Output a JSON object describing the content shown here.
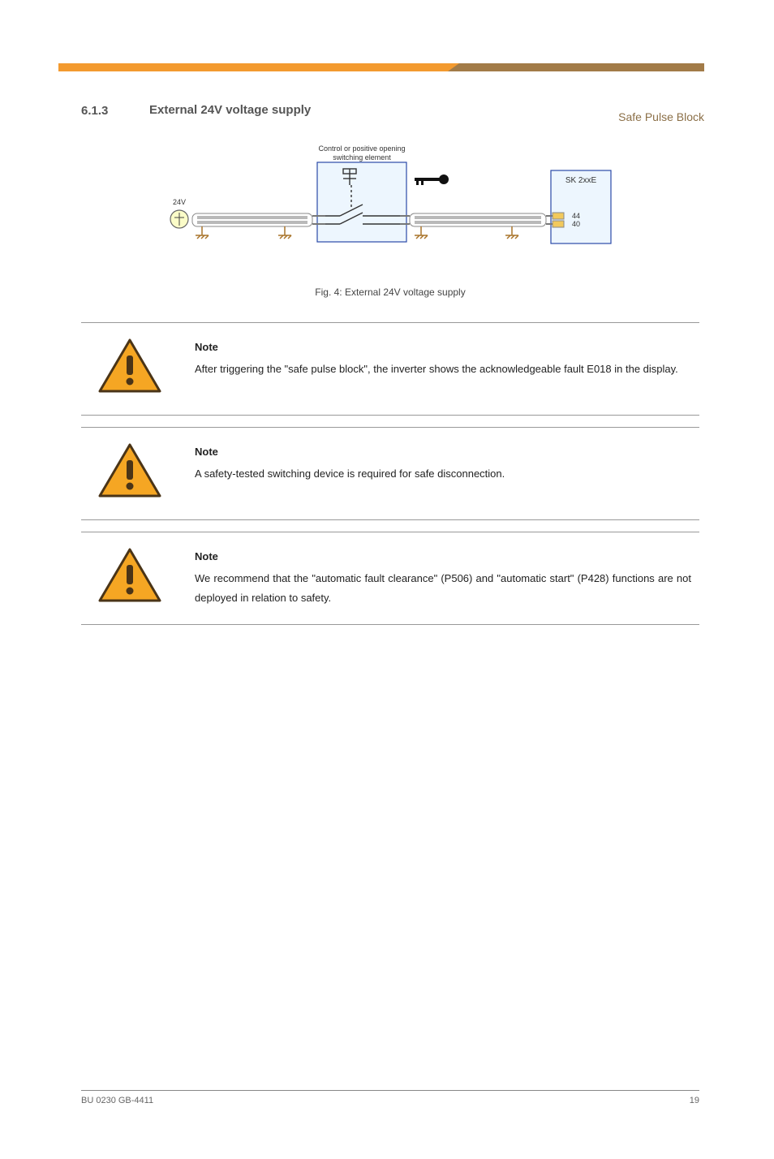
{
  "header": {
    "doc_title": "Safe Pulse Block"
  },
  "section": {
    "number": "6.1.3",
    "title": "External 24V voltage supply"
  },
  "figure": {
    "labels": {
      "source": "24V",
      "unit": "Control or positive opening\nswitching element",
      "device": "SK 2xxE",
      "port1": "44",
      "port2": "40"
    },
    "caption": "Fig. 4: External 24V voltage supply"
  },
  "notes": [
    {
      "label": "Note",
      "text": "After triggering the \"safe pulse block\", the inverter shows the acknowledgeable fault E018 in the display."
    },
    {
      "label": "Note",
      "text": "A safety-tested switching device is required for safe disconnection."
    },
    {
      "label": "Note",
      "text": "We recommend that the \"automatic fault clearance\" (P506) and \"automatic start\" (P428) functions are not deployed in relation to safety."
    }
  ],
  "footer": {
    "left": "BU 0230 GB-4411",
    "right": "19"
  }
}
